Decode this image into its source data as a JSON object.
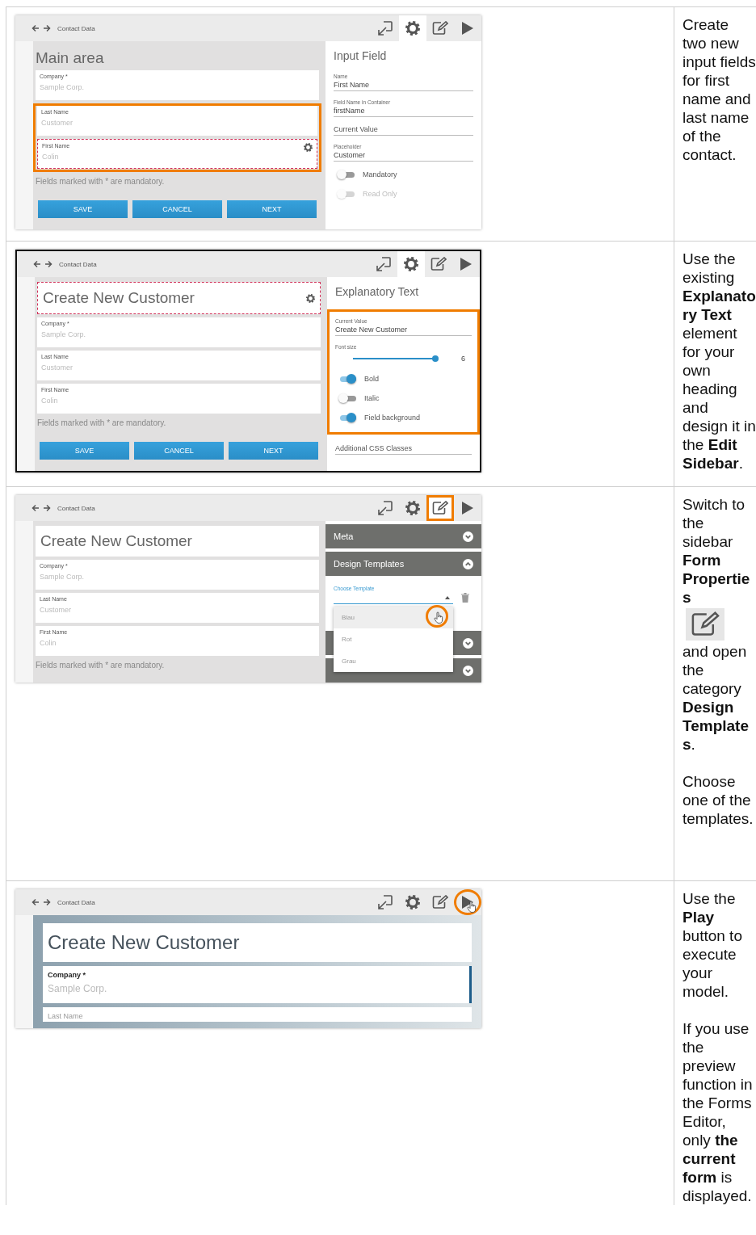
{
  "rows": [
    {
      "screenshot": {
        "framed": false,
        "preview": false,
        "breadcrumb": "Contact Data",
        "tools": [
          {
            "kind": "resize",
            "selected": false,
            "boxed": false,
            "circled": false
          },
          {
            "kind": "settings",
            "selected": true,
            "boxed": false,
            "circled": false
          },
          {
            "kind": "edit",
            "selected": false,
            "boxed": false,
            "circled": false
          },
          {
            "kind": "play",
            "selected": false,
            "boxed": false,
            "circled": false
          }
        ],
        "heading": {
          "text": "Main area",
          "kind": "plain"
        },
        "fields": [
          {
            "label": "Company *",
            "placeholder": "Sample Corp.",
            "highlighted": false,
            "outlined": false,
            "focused": false
          },
          {
            "label": "Last Name",
            "placeholder": "Customer",
            "highlighted": true,
            "outlined": false,
            "focused": false
          },
          {
            "label": "First Name",
            "placeholder": "Colin",
            "highlighted": true,
            "outlined": true,
            "focused": false
          }
        ],
        "note": "Fields marked with * are mandatory.",
        "buttons": [
          "SAVE",
          "CANCEL",
          "NEXT"
        ],
        "sidebar": {
          "kind": "properties",
          "title": "Input Field",
          "items": [
            {
              "kind": "field",
              "label": "Name",
              "value": "First Name"
            },
            {
              "kind": "field",
              "label": "Field Name in Container",
              "value": "firstName"
            },
            {
              "kind": "field",
              "placeholder": "Current Value"
            },
            {
              "kind": "field",
              "label": "Placeholder",
              "value": "Customer"
            },
            {
              "kind": "toggle",
              "label": "Mandatory",
              "on": false,
              "disabled": false
            },
            {
              "kind": "toggle",
              "label": "Read Only",
              "on": false,
              "disabled": true
            }
          ]
        }
      },
      "description": [
        {
          "parts": [
            {
              "kind": "text",
              "text": "Create two new input fields for first name and last name of the contact."
            }
          ]
        }
      ]
    },
    {
      "screenshot": {
        "framed": true,
        "preview": false,
        "breadcrumb": "Contact Data",
        "tools": [
          {
            "kind": "resize",
            "selected": false,
            "boxed": false,
            "circled": false
          },
          {
            "kind": "settings",
            "selected": true,
            "boxed": false,
            "circled": false
          },
          {
            "kind": "edit",
            "selected": false,
            "boxed": false,
            "circled": false
          },
          {
            "kind": "play",
            "selected": false,
            "boxed": false,
            "circled": false
          }
        ],
        "heading": {
          "text": "Create New Customer",
          "kind": "dashed"
        },
        "fields": [
          {
            "label": "Company *",
            "placeholder": "Sample Corp.",
            "highlighted": false,
            "outlined": false,
            "focused": false
          },
          {
            "label": "Last Name",
            "placeholder": "Customer",
            "highlighted": false,
            "outlined": false,
            "focused": false
          },
          {
            "label": "First Name",
            "placeholder": "Colin",
            "highlighted": false,
            "outlined": false,
            "focused": false
          }
        ],
        "note": "Fields marked with * are mandatory.",
        "buttons": [
          "SAVE",
          "CANCEL",
          "NEXT"
        ],
        "sidebar": {
          "kind": "properties",
          "title": "Explanatory Text",
          "items": [
            {
              "kind": "group",
              "highlighted": true,
              "items": [
                {
                  "kind": "field",
                  "label": "Current Value",
                  "value": "Create New Customer"
                },
                {
                  "kind": "slider",
                  "label": "Font size",
                  "level": 1,
                  "reading": "6"
                },
                {
                  "kind": "toggle",
                  "label": "Bold",
                  "on": true,
                  "disabled": false
                },
                {
                  "kind": "toggle",
                  "label": "Italic",
                  "on": false,
                  "disabled": false
                },
                {
                  "kind": "toggle",
                  "label": "Field background",
                  "on": true,
                  "disabled": false
                }
              ]
            },
            {
              "kind": "field",
              "placeholder": "Additional CSS Classes"
            }
          ]
        }
      },
      "description": [
        {
          "parts": [
            {
              "kind": "text",
              "text": "Use the existing **Explanatory Text** element for your own heading and design it in the **Edit Sidebar**."
            }
          ]
        }
      ]
    },
    {
      "screenshot": {
        "framed": false,
        "preview": false,
        "breadcrumb": "Contact Data",
        "tools": [
          {
            "kind": "resize",
            "selected": false,
            "boxed": false,
            "circled": false
          },
          {
            "kind": "settings",
            "selected": false,
            "boxed": false,
            "circled": false
          },
          {
            "kind": "edit",
            "selected": true,
            "boxed": true,
            "circled": false
          },
          {
            "kind": "play",
            "selected": false,
            "boxed": false,
            "circled": false
          }
        ],
        "heading": {
          "text": "Create New Customer",
          "kind": "boxed"
        },
        "fields": [
          {
            "label": "Company *",
            "placeholder": "Sample Corp.",
            "highlighted": false,
            "outlined": false,
            "focused": false
          },
          {
            "label": "Last Name",
            "placeholder": "Customer",
            "highlighted": false,
            "outlined": false,
            "focused": false
          },
          {
            "label": "First Name",
            "placeholder": "Colin",
            "highlighted": false,
            "outlined": false,
            "focused": false
          }
        ],
        "note": "Fields marked with * are mandatory.",
        "sidebar": {
          "kind": "accordion",
          "panels": [
            {
              "title": "Meta",
              "expanded": false
            },
            {
              "title": "Design Templates",
              "expanded": true,
              "select": {
                "label": "Choose Template",
                "open": true,
                "options": [
                  {
                    "label": "Blau",
                    "hovered": true
                  },
                  {
                    "label": "Rot",
                    "hovered": false
                  },
                  {
                    "label": "Grau",
                    "hovered": false
                  }
                ]
              }
            },
            {
              "expanded": false
            },
            {
              "expanded": false
            }
          ]
        }
      },
      "description": [
        {
          "parts": [
            {
              "kind": "text",
              "text": "Switch to the sidebar **Form Properties**"
            },
            {
              "kind": "icon"
            },
            {
              "kind": "text",
              "text": "and open the category **Design Templates**."
            }
          ]
        },
        {
          "parts": [
            {
              "kind": "text",
              "text": "Choose one of the templates."
            }
          ]
        }
      ]
    },
    {
      "screenshot": {
        "framed": false,
        "preview": true,
        "breadcrumb": "Contact Data",
        "tools": [
          {
            "kind": "resize",
            "selected": false,
            "boxed": false,
            "circled": false
          },
          {
            "kind": "settings",
            "selected": false,
            "boxed": false,
            "circled": false
          },
          {
            "kind": "edit",
            "selected": false,
            "boxed": false,
            "circled": false
          },
          {
            "kind": "play",
            "selected": false,
            "boxed": false,
            "circled": true
          }
        ],
        "heading": {
          "text": "Create New Customer",
          "kind": "boxed"
        },
        "fields": [
          {
            "label": "Company *",
            "placeholder": "Sample Corp.",
            "highlighted": false,
            "outlined": false,
            "focused": true
          },
          {
            "label": "Last Name",
            "highlighted": false,
            "outlined": false,
            "focused": false
          }
        ]
      },
      "description": [
        {
          "parts": [
            {
              "kind": "text",
              "text": "Use the **Play** button to execute your model."
            }
          ]
        },
        {
          "parts": [
            {
              "kind": "text",
              "text": "If you use the preview function in the Forms Editor, only **the current form** is displayed."
            }
          ]
        }
      ]
    }
  ]
}
